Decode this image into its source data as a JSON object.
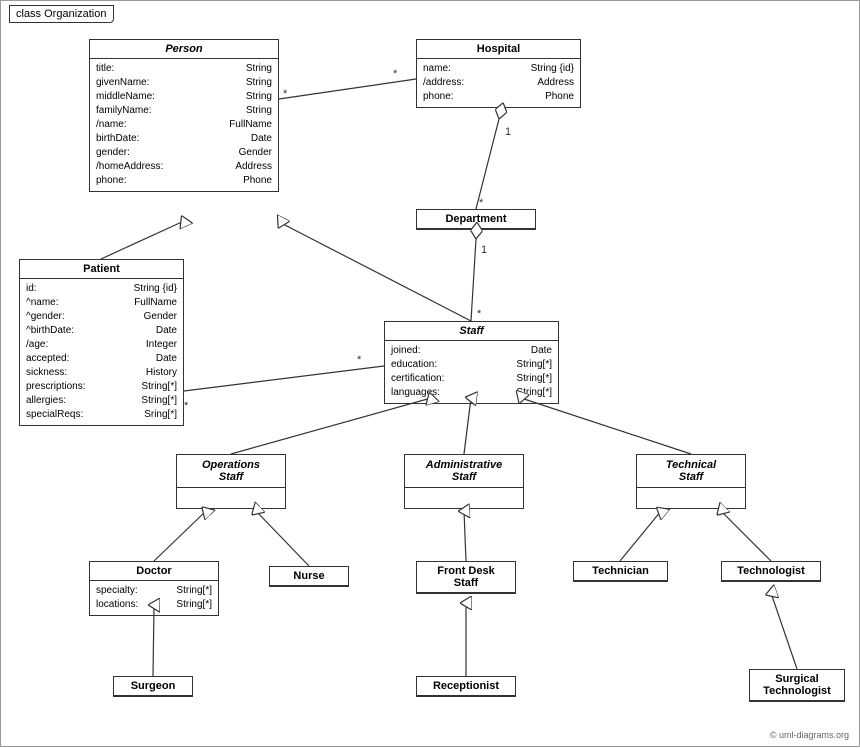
{
  "diagram": {
    "title": "class Organization",
    "copyright": "© uml-diagrams.org",
    "classes": {
      "person": {
        "name": "Person",
        "italic_title": true,
        "attrs": [
          [
            "title:",
            "String"
          ],
          [
            "givenName:",
            "String"
          ],
          [
            "middleName:",
            "String"
          ],
          [
            "familyName:",
            "String"
          ],
          [
            "/name:",
            "FullName"
          ],
          [
            "birthDate:",
            "Date"
          ],
          [
            "gender:",
            "Gender"
          ],
          [
            "/homeAddress:",
            "Address"
          ],
          [
            "phone:",
            "Phone"
          ]
        ]
      },
      "hospital": {
        "name": "Hospital",
        "italic_title": false,
        "attrs": [
          [
            "name:",
            "String {id}"
          ],
          [
            "/address:",
            "Address"
          ],
          [
            "phone:",
            "Phone"
          ]
        ]
      },
      "patient": {
        "name": "Patient",
        "italic_title": false,
        "attrs": [
          [
            "id:",
            "String {id}"
          ],
          [
            "^name:",
            "FullName"
          ],
          [
            "^gender:",
            "Gender"
          ],
          [
            "^birthDate:",
            "Date"
          ],
          [
            "/age:",
            "Integer"
          ],
          [
            "accepted:",
            "Date"
          ],
          [
            "sickness:",
            "History"
          ],
          [
            "prescriptions:",
            "String[*]"
          ],
          [
            "allergies:",
            "String[*]"
          ],
          [
            "specialReqs:",
            "Sring[*]"
          ]
        ]
      },
      "department": {
        "name": "Department",
        "italic_title": false,
        "attrs": []
      },
      "staff": {
        "name": "Staff",
        "italic_title": true,
        "attrs": [
          [
            "joined:",
            "Date"
          ],
          [
            "education:",
            "String[*]"
          ],
          [
            "certification:",
            "String[*]"
          ],
          [
            "languages:",
            "String[*]"
          ]
        ]
      },
      "operations_staff": {
        "name": "Operations\nStaff",
        "italic_title": true,
        "attrs": []
      },
      "administrative_staff": {
        "name": "Administrative\nStaff",
        "italic_title": true,
        "attrs": []
      },
      "technical_staff": {
        "name": "Technical\nStaff",
        "italic_title": true,
        "attrs": []
      },
      "doctor": {
        "name": "Doctor",
        "italic_title": false,
        "attrs": [
          [
            "specialty:",
            "String[*]"
          ],
          [
            "locations:",
            "String[*]"
          ]
        ]
      },
      "nurse": {
        "name": "Nurse",
        "italic_title": false,
        "attrs": []
      },
      "front_desk_staff": {
        "name": "Front Desk\nStaff",
        "italic_title": false,
        "attrs": []
      },
      "technician": {
        "name": "Technician",
        "italic_title": false,
        "attrs": []
      },
      "technologist": {
        "name": "Technologist",
        "italic_title": false,
        "attrs": []
      },
      "surgeon": {
        "name": "Surgeon",
        "italic_title": false,
        "attrs": []
      },
      "receptionist": {
        "name": "Receptionist",
        "italic_title": false,
        "attrs": []
      },
      "surgical_technologist": {
        "name": "Surgical\nTechnologist",
        "italic_title": false,
        "attrs": []
      }
    }
  }
}
